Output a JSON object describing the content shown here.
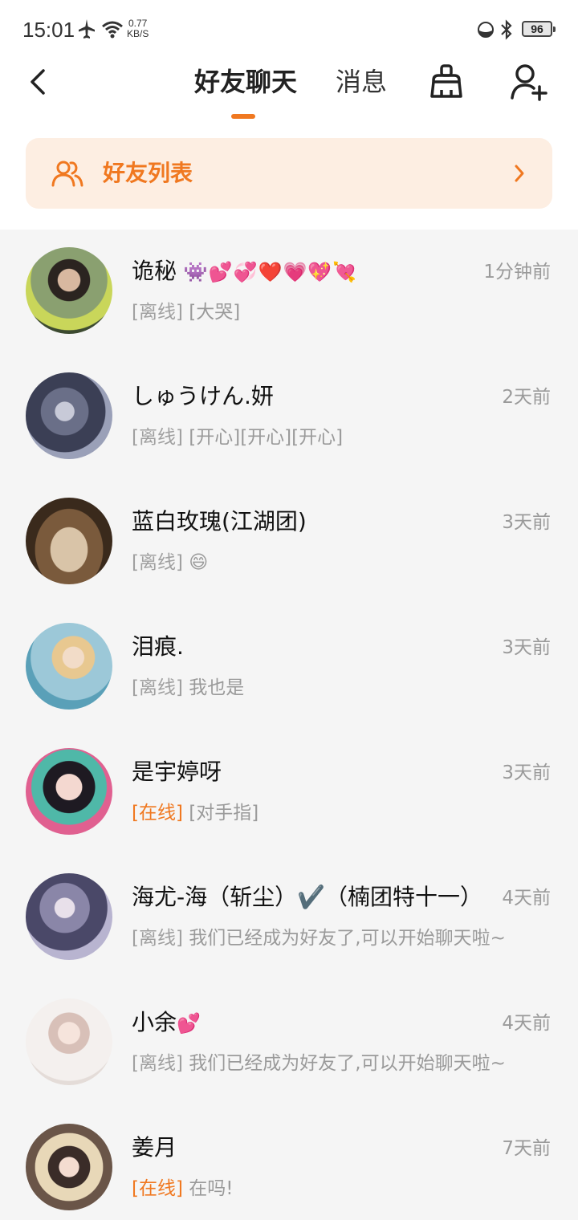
{
  "status_bar": {
    "time": "15:01",
    "network_speed_value": "0.77",
    "network_speed_unit": "KB/S",
    "battery": "96",
    "icons": [
      "airplane-icon",
      "wifi-icon",
      "data-saver-icon",
      "bluetooth-icon"
    ]
  },
  "nav": {
    "tabs": [
      {
        "label": "好友聊天",
        "active": true
      },
      {
        "label": "消息",
        "active": false
      }
    ],
    "accent_color": "#f07820",
    "icons": [
      "back-icon",
      "clean-broom-icon",
      "add-user-icon"
    ]
  },
  "friend_list_banner": {
    "label": "好友列表",
    "background_color": "#fdeee2"
  },
  "chats": [
    {
      "name": "诡秘",
      "name_emoji": "👾💕💞❤️💗💖💘",
      "time": "1分钟前",
      "status": "[离线]",
      "online": false,
      "preview": "[大哭]"
    },
    {
      "name": "しゅうけん.妍",
      "name_emoji": "",
      "time": "2天前",
      "status": "[离线]",
      "online": false,
      "preview": "[开心][开心][开心]"
    },
    {
      "name": "蓝白玫瑰(江湖团)",
      "name_emoji": "",
      "time": "3天前",
      "status": "[离线]",
      "online": false,
      "preview": "😄"
    },
    {
      "name": "泪痕.",
      "name_emoji": "",
      "time": "3天前",
      "status": "[离线]",
      "online": false,
      "preview": "我也是"
    },
    {
      "name": "是宇婷呀",
      "name_emoji": "",
      "time": "3天前",
      "status": "[在线]",
      "online": true,
      "preview": "[对手指]"
    },
    {
      "name": "海尤-海（斩尘）✔️（楠团特十一）",
      "name_emoji": "",
      "time": "4天前",
      "status": "[离线]",
      "online": false,
      "preview": "我们已经成为好友了,可以开始聊天啦~"
    },
    {
      "name": "小余",
      "name_emoji": "💕",
      "time": "4天前",
      "status": "[离线]",
      "online": false,
      "preview": "我们已经成为好友了,可以开始聊天啦~"
    },
    {
      "name": "姜月",
      "name_emoji": "",
      "time": "7天前",
      "status": "[在线]",
      "online": true,
      "preview": "在吗!"
    }
  ]
}
